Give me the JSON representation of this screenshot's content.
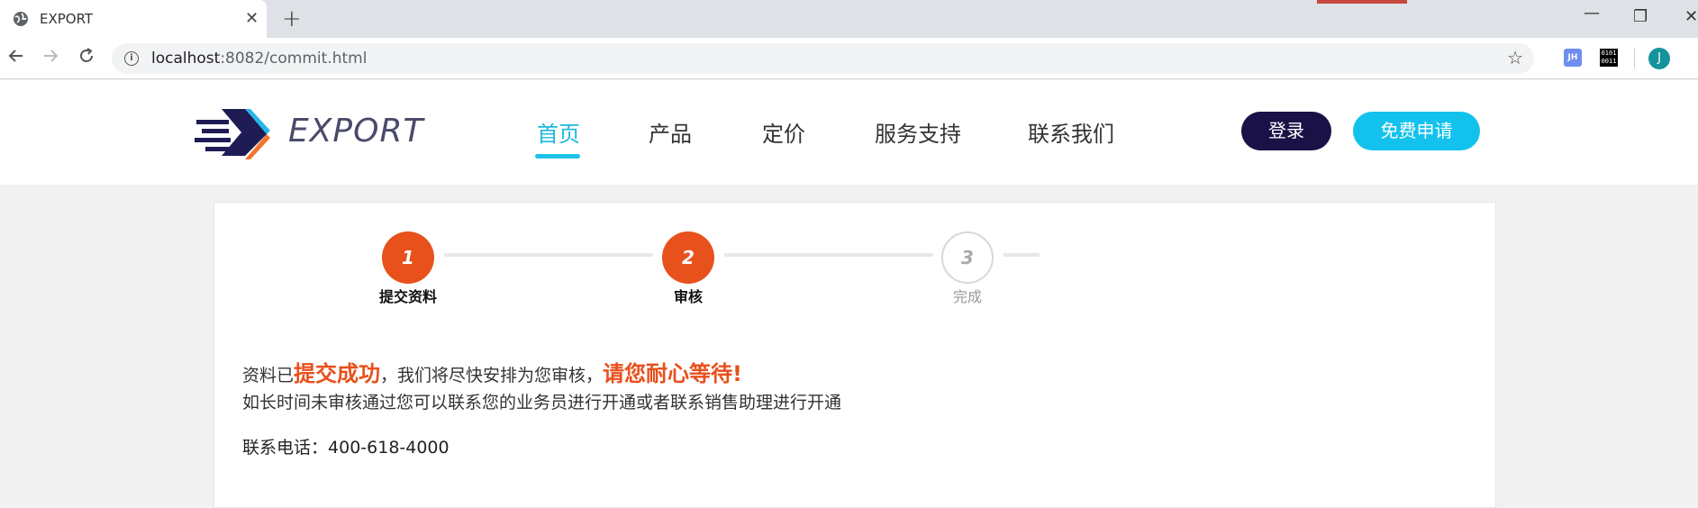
{
  "browser": {
    "tab_title": "EXPORT",
    "tab_close": "✕",
    "new_tab": "+",
    "url_host": "localhost",
    "url_path": ":8082/commit.html",
    "ext_jh": "JH",
    "ext_bin": "0101 0011",
    "avatar_letter": "J",
    "window": {
      "minimize": "—",
      "restore": "❐",
      "close": "✕"
    }
  },
  "site": {
    "logo_text": "EXPORT",
    "nav": [
      {
        "label": "首页",
        "active": true
      },
      {
        "label": "产品",
        "active": false
      },
      {
        "label": "定价",
        "active": false
      },
      {
        "label": "服务支持",
        "active": false
      },
      {
        "label": "联系我们",
        "active": false
      }
    ],
    "login_label": "登录",
    "apply_label": "免费申请",
    "colors": {
      "accent": "#12c2ed",
      "dark": "#1a1147",
      "orange": "#e8501c"
    }
  },
  "steps": [
    {
      "number": "1",
      "label": "提交资料",
      "status": "done"
    },
    {
      "number": "2",
      "label": "审核",
      "status": "done"
    },
    {
      "number": "3",
      "label": "完成",
      "status": "pending"
    }
  ],
  "message": {
    "prefix": "资料已",
    "highlight1": "提交成功",
    "middle": "，我们将尽快安排为您审核，",
    "highlight2": "请您耐心等待!",
    "line2": "如长时间未审核通过您可以联系您的业务员进行开通或者联系销售助理进行开通",
    "phone_label": "联系电话：",
    "phone_number": "400-618-4000"
  }
}
